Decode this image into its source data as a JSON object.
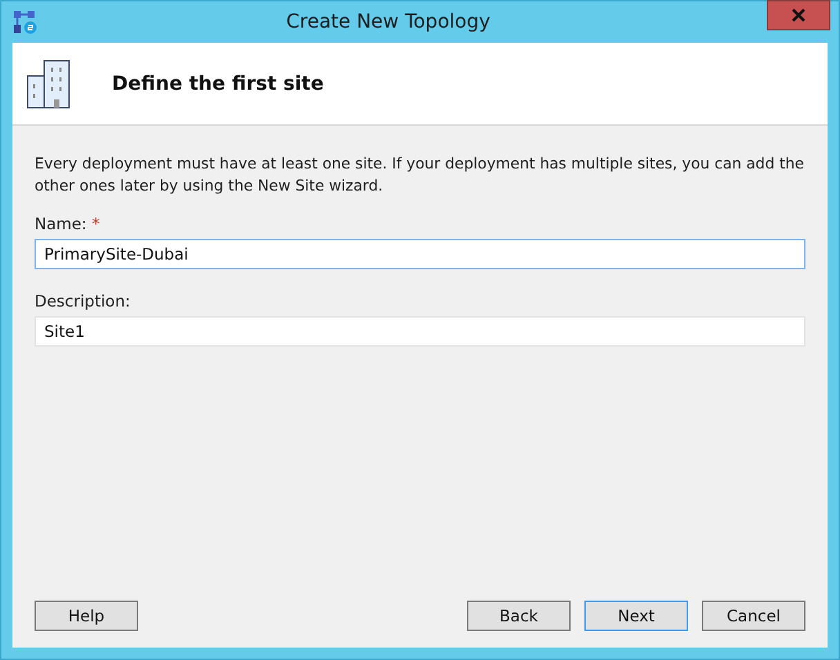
{
  "window": {
    "title": "Create New Topology"
  },
  "header": {
    "title": "Define the first site"
  },
  "intro": "Every deployment must have at least one site. If your deployment has multiple sites, you can add the other ones later by using the New Site wizard.",
  "fields": [
    {
      "label": "Name:",
      "required_mark": "*",
      "value": "PrimarySite-Dubai",
      "focused": true
    },
    {
      "label": "Description:",
      "value": "Site1",
      "focused": false
    }
  ],
  "left_buttons": [
    {
      "label": "Help",
      "default": false
    }
  ],
  "right_buttons": [
    {
      "label": "Back",
      "default": false
    },
    {
      "label": "Next",
      "default": true
    },
    {
      "label": "Cancel",
      "default": false
    }
  ]
}
